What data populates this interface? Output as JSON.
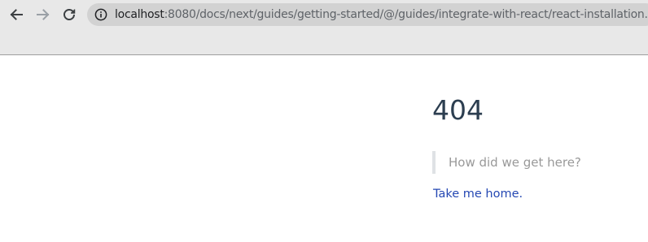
{
  "browser": {
    "back_icon": "arrow-left-icon",
    "forward_icon": "arrow-right-icon",
    "reload_icon": "reload-icon",
    "info_icon": "info-icon",
    "address_bar": {
      "host": "localhost",
      "path": ":8080/docs/next/guides/getting-started/@/guides/integrate-with-react/react-installation.html"
    }
  },
  "page": {
    "error_code": "404",
    "quote": "How did we get here?",
    "home_link": "Take me home."
  },
  "colors": {
    "heading": "#2c3e50",
    "quote_text": "#999999",
    "quote_border": "#dfe2e5",
    "link": "#2548b3",
    "toolbar": "#e8e8e8",
    "omnibox": "#d2d2d2"
  }
}
